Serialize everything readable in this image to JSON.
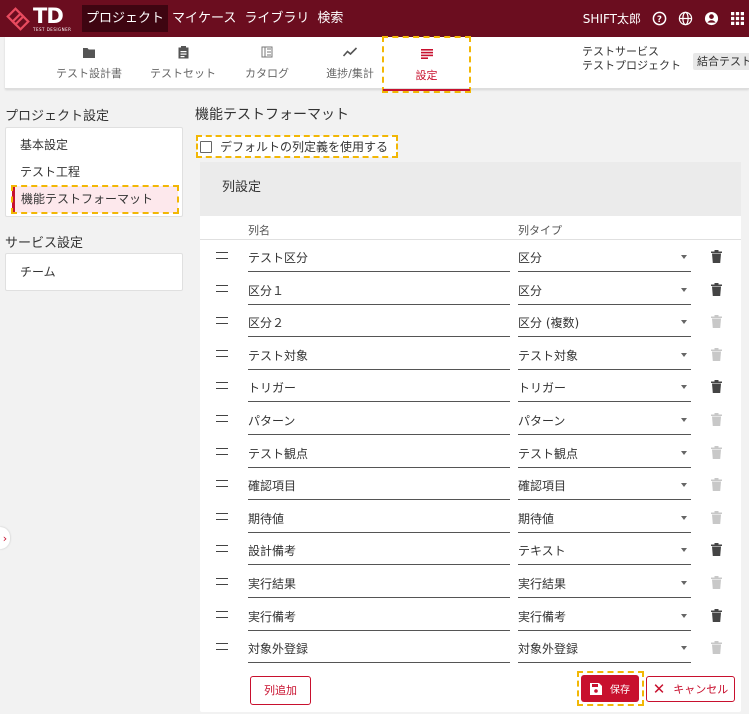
{
  "brand": {
    "logo_text": "TD",
    "logo_sub": "TEST DESIGNER"
  },
  "topnav": [
    {
      "label": "プロジェクト",
      "active": true
    },
    {
      "label": "マイケース",
      "active": false
    },
    {
      "label": "ライブラリ",
      "active": false
    },
    {
      "label": "検索",
      "active": false
    }
  ],
  "user": {
    "name": "SHIFT太郎"
  },
  "tabs": [
    {
      "label": "テスト設計書",
      "icon": "folder-icon"
    },
    {
      "label": "テストセット",
      "icon": "clipboard-icon"
    },
    {
      "label": "カタログ",
      "icon": "catalog-icon"
    },
    {
      "label": "進捗/集計",
      "icon": "chart-line-icon"
    },
    {
      "label": "設定",
      "icon": "settings-list-icon",
      "active": true
    }
  ],
  "project": {
    "service": "テストサービス",
    "name": "テストプロジェクト",
    "badge": "結合テスト"
  },
  "sidebar": {
    "project_heading": "プロジェクト設定",
    "project_items": [
      "基本設定",
      "テスト工程",
      "機能テストフォーマット"
    ],
    "service_heading": "サービス設定",
    "service_items": [
      "チーム"
    ]
  },
  "main": {
    "title": "機能テストフォーマット",
    "default_checkbox_label": "デフォルトの列定義を使用する",
    "panel_title": "列設定",
    "col_name_header": "列名",
    "col_type_header": "列タイプ",
    "add_button": "列追加",
    "save_button": "保存",
    "cancel_button": "キャンセル"
  },
  "columns": [
    {
      "name": "テスト区分",
      "type": "区分",
      "deletable": true
    },
    {
      "name": "区分１",
      "type": "区分",
      "deletable": true
    },
    {
      "name": "区分２",
      "type": "区分 (複数)",
      "deletable": false
    },
    {
      "name": "テスト対象",
      "type": "テスト対象",
      "deletable": false
    },
    {
      "name": "トリガー",
      "type": "トリガー",
      "deletable": true
    },
    {
      "name": "パターン",
      "type": "パターン",
      "deletable": false
    },
    {
      "name": "テスト観点",
      "type": "テスト観点",
      "deletable": false
    },
    {
      "name": "確認項目",
      "type": "確認項目",
      "deletable": false
    },
    {
      "name": "期待値",
      "type": "期待値",
      "deletable": false
    },
    {
      "name": "設計備考",
      "type": "テキスト",
      "deletable": true
    },
    {
      "name": "実行結果",
      "type": "実行結果",
      "deletable": false
    },
    {
      "name": "実行備考",
      "type": "実行備考",
      "deletable": true
    },
    {
      "name": "対象外登録",
      "type": "対象外登録",
      "deletable": false
    }
  ],
  "colors": {
    "brand": "#6b0d1f",
    "accent": "#c8102e",
    "highlight": "#f2b705"
  }
}
